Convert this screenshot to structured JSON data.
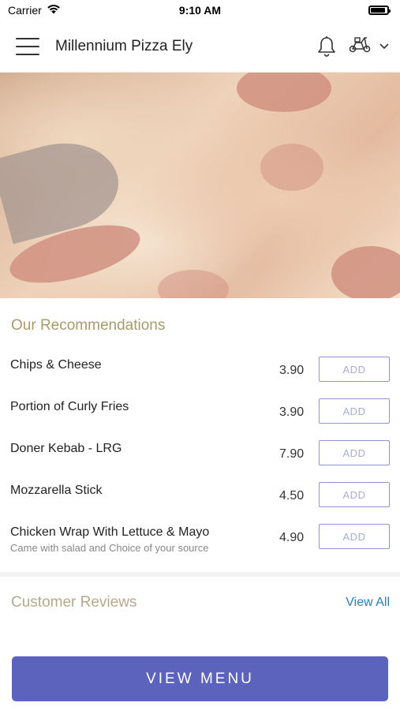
{
  "status_bar": {
    "carrier": "Carrier",
    "time": "9:10 AM"
  },
  "header": {
    "title": "Millennium Pizza Ely",
    "icons": [
      "menu-icon",
      "bell-icon",
      "delivery-scooter-icon",
      "chevron-down-icon"
    ]
  },
  "hero": {
    "image": "pizza-photo"
  },
  "recommendations": {
    "title": "Our Recommendations",
    "add_label": "ADD",
    "items": [
      {
        "name": "Chips & Cheese",
        "price": "3.90",
        "description": ""
      },
      {
        "name": "Portion of Curly Fries",
        "price": "3.90",
        "description": ""
      },
      {
        "name": "Doner Kebab - LRG",
        "price": "7.90",
        "description": ""
      },
      {
        "name": "Mozzarella Stick",
        "price": "4.50",
        "description": ""
      },
      {
        "name": "Chicken Wrap With Lettuce & Mayo",
        "price": "4.90",
        "description": "Came with salad and Choice of your source"
      }
    ]
  },
  "reviews": {
    "title": "Customer Reviews",
    "view_all": "View All"
  },
  "cta": {
    "label": "VIEW MENU"
  },
  "colors": {
    "accent": "#5b63bd",
    "section_title": "#a89a6d",
    "link": "#2a7fb1",
    "add_border": "#8f95cf"
  }
}
